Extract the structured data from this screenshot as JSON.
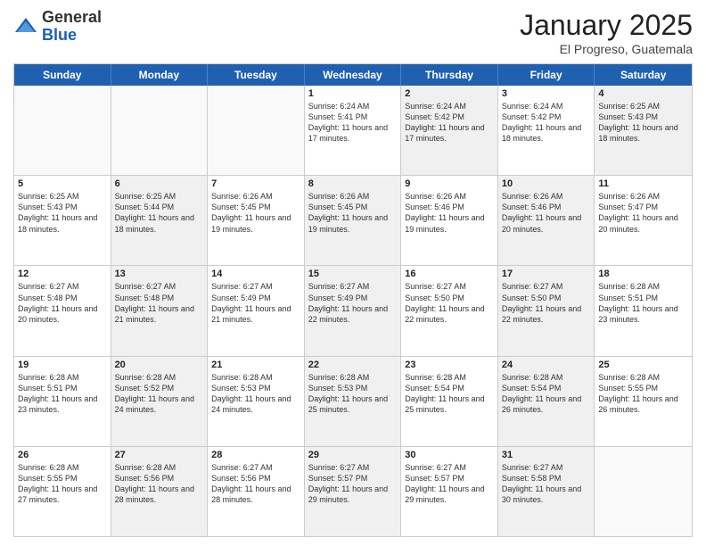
{
  "header": {
    "logo_general": "General",
    "logo_blue": "Blue",
    "title": "January 2025",
    "location": "El Progreso, Guatemala"
  },
  "days_of_week": [
    "Sunday",
    "Monday",
    "Tuesday",
    "Wednesday",
    "Thursday",
    "Friday",
    "Saturday"
  ],
  "weeks": [
    [
      {
        "day": "",
        "text": "",
        "shaded": false,
        "empty": true
      },
      {
        "day": "",
        "text": "",
        "shaded": false,
        "empty": true
      },
      {
        "day": "",
        "text": "",
        "shaded": false,
        "empty": true
      },
      {
        "day": "1",
        "text": "Sunrise: 6:24 AM\nSunset: 5:41 PM\nDaylight: 11 hours and 17 minutes.",
        "shaded": false,
        "empty": false
      },
      {
        "day": "2",
        "text": "Sunrise: 6:24 AM\nSunset: 5:42 PM\nDaylight: 11 hours and 17 minutes.",
        "shaded": true,
        "empty": false
      },
      {
        "day": "3",
        "text": "Sunrise: 6:24 AM\nSunset: 5:42 PM\nDaylight: 11 hours and 18 minutes.",
        "shaded": false,
        "empty": false
      },
      {
        "day": "4",
        "text": "Sunrise: 6:25 AM\nSunset: 5:43 PM\nDaylight: 11 hours and 18 minutes.",
        "shaded": true,
        "empty": false
      }
    ],
    [
      {
        "day": "5",
        "text": "Sunrise: 6:25 AM\nSunset: 5:43 PM\nDaylight: 11 hours and 18 minutes.",
        "shaded": false,
        "empty": false
      },
      {
        "day": "6",
        "text": "Sunrise: 6:25 AM\nSunset: 5:44 PM\nDaylight: 11 hours and 18 minutes.",
        "shaded": true,
        "empty": false
      },
      {
        "day": "7",
        "text": "Sunrise: 6:26 AM\nSunset: 5:45 PM\nDaylight: 11 hours and 19 minutes.",
        "shaded": false,
        "empty": false
      },
      {
        "day": "8",
        "text": "Sunrise: 6:26 AM\nSunset: 5:45 PM\nDaylight: 11 hours and 19 minutes.",
        "shaded": true,
        "empty": false
      },
      {
        "day": "9",
        "text": "Sunrise: 6:26 AM\nSunset: 5:46 PM\nDaylight: 11 hours and 19 minutes.",
        "shaded": false,
        "empty": false
      },
      {
        "day": "10",
        "text": "Sunrise: 6:26 AM\nSunset: 5:46 PM\nDaylight: 11 hours and 20 minutes.",
        "shaded": true,
        "empty": false
      },
      {
        "day": "11",
        "text": "Sunrise: 6:26 AM\nSunset: 5:47 PM\nDaylight: 11 hours and 20 minutes.",
        "shaded": false,
        "empty": false
      }
    ],
    [
      {
        "day": "12",
        "text": "Sunrise: 6:27 AM\nSunset: 5:48 PM\nDaylight: 11 hours and 20 minutes.",
        "shaded": false,
        "empty": false
      },
      {
        "day": "13",
        "text": "Sunrise: 6:27 AM\nSunset: 5:48 PM\nDaylight: 11 hours and 21 minutes.",
        "shaded": true,
        "empty": false
      },
      {
        "day": "14",
        "text": "Sunrise: 6:27 AM\nSunset: 5:49 PM\nDaylight: 11 hours and 21 minutes.",
        "shaded": false,
        "empty": false
      },
      {
        "day": "15",
        "text": "Sunrise: 6:27 AM\nSunset: 5:49 PM\nDaylight: 11 hours and 22 minutes.",
        "shaded": true,
        "empty": false
      },
      {
        "day": "16",
        "text": "Sunrise: 6:27 AM\nSunset: 5:50 PM\nDaylight: 11 hours and 22 minutes.",
        "shaded": false,
        "empty": false
      },
      {
        "day": "17",
        "text": "Sunrise: 6:27 AM\nSunset: 5:50 PM\nDaylight: 11 hours and 22 minutes.",
        "shaded": true,
        "empty": false
      },
      {
        "day": "18",
        "text": "Sunrise: 6:28 AM\nSunset: 5:51 PM\nDaylight: 11 hours and 23 minutes.",
        "shaded": false,
        "empty": false
      }
    ],
    [
      {
        "day": "19",
        "text": "Sunrise: 6:28 AM\nSunset: 5:51 PM\nDaylight: 11 hours and 23 minutes.",
        "shaded": false,
        "empty": false
      },
      {
        "day": "20",
        "text": "Sunrise: 6:28 AM\nSunset: 5:52 PM\nDaylight: 11 hours and 24 minutes.",
        "shaded": true,
        "empty": false
      },
      {
        "day": "21",
        "text": "Sunrise: 6:28 AM\nSunset: 5:53 PM\nDaylight: 11 hours and 24 minutes.",
        "shaded": false,
        "empty": false
      },
      {
        "day": "22",
        "text": "Sunrise: 6:28 AM\nSunset: 5:53 PM\nDaylight: 11 hours and 25 minutes.",
        "shaded": true,
        "empty": false
      },
      {
        "day": "23",
        "text": "Sunrise: 6:28 AM\nSunset: 5:54 PM\nDaylight: 11 hours and 25 minutes.",
        "shaded": false,
        "empty": false
      },
      {
        "day": "24",
        "text": "Sunrise: 6:28 AM\nSunset: 5:54 PM\nDaylight: 11 hours and 26 minutes.",
        "shaded": true,
        "empty": false
      },
      {
        "day": "25",
        "text": "Sunrise: 6:28 AM\nSunset: 5:55 PM\nDaylight: 11 hours and 26 minutes.",
        "shaded": false,
        "empty": false
      }
    ],
    [
      {
        "day": "26",
        "text": "Sunrise: 6:28 AM\nSunset: 5:55 PM\nDaylight: 11 hours and 27 minutes.",
        "shaded": false,
        "empty": false
      },
      {
        "day": "27",
        "text": "Sunrise: 6:28 AM\nSunset: 5:56 PM\nDaylight: 11 hours and 28 minutes.",
        "shaded": true,
        "empty": false
      },
      {
        "day": "28",
        "text": "Sunrise: 6:27 AM\nSunset: 5:56 PM\nDaylight: 11 hours and 28 minutes.",
        "shaded": false,
        "empty": false
      },
      {
        "day": "29",
        "text": "Sunrise: 6:27 AM\nSunset: 5:57 PM\nDaylight: 11 hours and 29 minutes.",
        "shaded": true,
        "empty": false
      },
      {
        "day": "30",
        "text": "Sunrise: 6:27 AM\nSunset: 5:57 PM\nDaylight: 11 hours and 29 minutes.",
        "shaded": false,
        "empty": false
      },
      {
        "day": "31",
        "text": "Sunrise: 6:27 AM\nSunset: 5:58 PM\nDaylight: 11 hours and 30 minutes.",
        "shaded": true,
        "empty": false
      },
      {
        "day": "",
        "text": "",
        "shaded": false,
        "empty": true
      }
    ]
  ]
}
